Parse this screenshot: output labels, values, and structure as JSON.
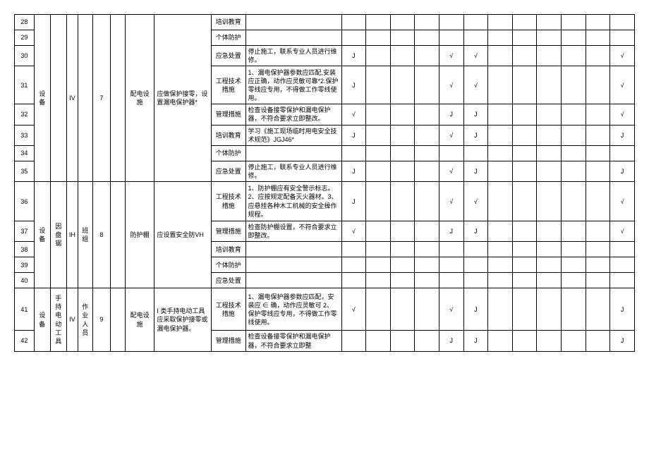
{
  "rows": {
    "r28": {
      "idx": "28",
      "i": "培训教育",
      "j": ""
    },
    "r29": {
      "idx": "29",
      "i": "个体防护",
      "j": ""
    },
    "r30": {
      "idx": "30",
      "i": "应急处置",
      "j": "停止施工，联系专业人员进行维修。",
      "m1": "J",
      "m5": "√",
      "m6": "√",
      "m12": "√"
    },
    "r31": {
      "idx": "31",
      "i": "工程技术措施",
      "j": "1、漏电保护器参数应匹配,安装应正确，动作应灵敏可靠*2.保护零线应专用，不得做工作零线使用。",
      "m1": "J",
      "m5": "√",
      "m6": "√",
      "m12": "√"
    },
    "r32": {
      "idx": "32",
      "a": "设备",
      "c": "IV",
      "e": "7",
      "g": "配电设施",
      "h": "应做保护接零，设置漏电保护器*",
      "i": "管理措施",
      "j": "检查设备接零保护和漏电保护器，不符合要求立即整改。",
      "m1": "√",
      "m5": "J",
      "m6": "J",
      "m12": "√"
    },
    "r33": {
      "idx": "33",
      "i": "培训教育",
      "j": "学习《施工现场临时用电安全技术规范》JGJ46*",
      "m1": "J",
      "m5": "√",
      "m6": "J",
      "m12": "J"
    },
    "r34": {
      "idx": "34",
      "i": "个体防护",
      "j": ""
    },
    "r35": {
      "idx": "35",
      "i": "应急处置",
      "j": "停止施工，联系专业人员进行维修。",
      "m1": "J",
      "m5": "√",
      "m6": "J",
      "m12": "J"
    },
    "r36": {
      "idx": "36",
      "i": "工程技术措施",
      "j": "1、防护棚应有安全警示标志。2、应按规定配备灭火器材。3、应悬挂各种木工机械的安全操作规程。",
      "m1": "J",
      "m5": "√",
      "m6": "√",
      "m12": "√"
    },
    "r37": {
      "idx": "37",
      "a": "设备",
      "b": "因盘锯",
      "c": "IH",
      "d": "班组",
      "e": "8",
      "g": "防护棚",
      "h": "应设置安全防VH",
      "i": "管理措施",
      "j": "检查防护棚设置，不符合要求立即整改。",
      "m1": "√",
      "m5": "J",
      "m6": "J",
      "m12": "√"
    },
    "r38": {
      "idx": "38",
      "i": "培训教育",
      "j": ""
    },
    "r39": {
      "idx": "39",
      "i": "个体防护",
      "j": ""
    },
    "r40": {
      "idx": "40",
      "i": "应急处置",
      "j": ""
    },
    "r41": {
      "idx": "41",
      "a": "设备",
      "b": "手持电动工具",
      "c": "IV",
      "d": "作业人员",
      "e": "9",
      "g": "配电设施",
      "h": "I 类手持电动工具应采取保护接零或漏电保护器。",
      "i": "工程技术措施",
      "j": "1、漏电保护器参数应匹配，安装应 ∈ 确，动作应灵敏可\n2、保护零线应专用，不得做工作零线使用。",
      "m1": "√",
      "m5": "√",
      "m6": "J",
      "m12": "J"
    },
    "r42": {
      "idx": "42",
      "i": "管理措施",
      "j": "检查设备接零保护和漏电保护器，不符合要求立即整",
      "m1": "",
      "m5": "J",
      "m6": "J",
      "m12": "J"
    }
  }
}
